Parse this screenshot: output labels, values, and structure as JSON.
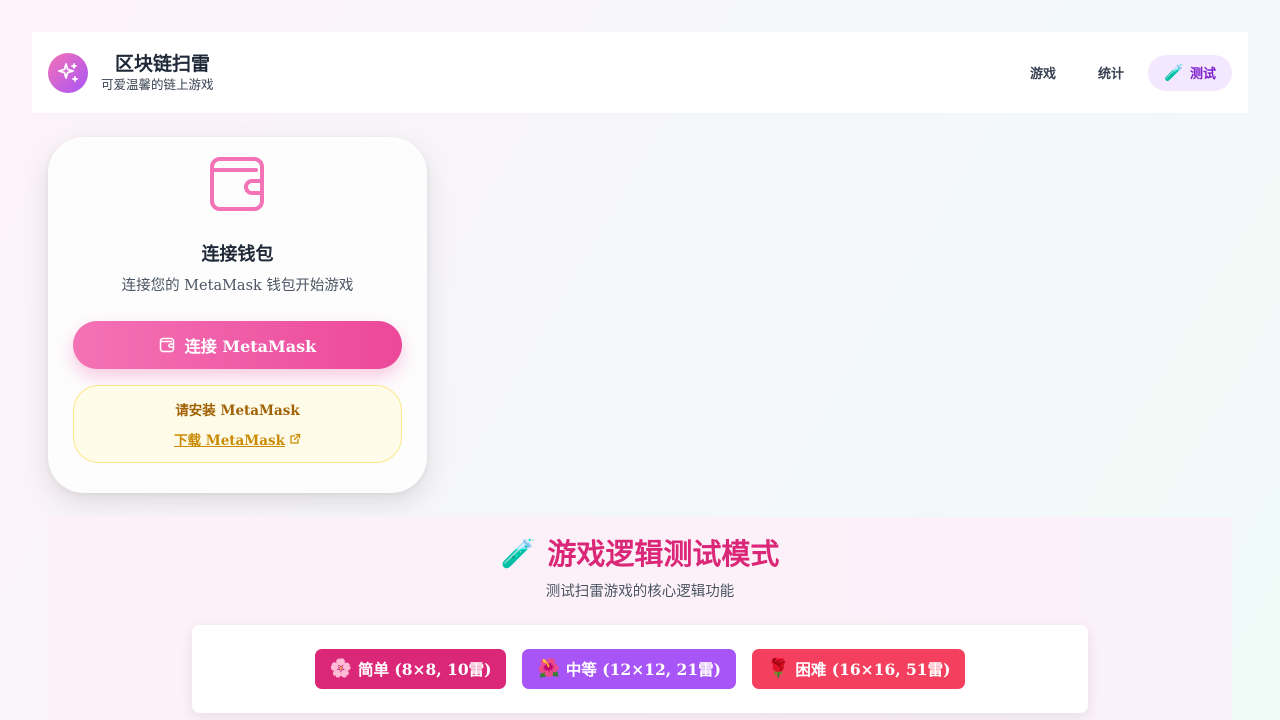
{
  "header": {
    "title": "区块链扫雷",
    "subtitle": "可爱温馨的链上游戏",
    "logo_icon": "sparkles-icon",
    "nav": [
      {
        "label": "游戏",
        "active": false
      },
      {
        "label": "统计",
        "active": false
      },
      {
        "label": "测试",
        "icon": "🧪",
        "active": true
      }
    ]
  },
  "wallet": {
    "icon": "wallet-icon",
    "title": "连接钱包",
    "description": "连接您的 MetaMask 钱包开始游戏",
    "connect_label": "连接 MetaMask",
    "install_title": "请安装 MetaMask",
    "download_label": "下载 MetaMask"
  },
  "test_mode": {
    "icon": "🧪",
    "title": "游戏逻辑测试模式",
    "subtitle": "测试扫雷游戏的核心逻辑功能",
    "difficulties": [
      {
        "icon": "🌸",
        "label": "简单 (8×8, 10雷)",
        "color": "#db2777"
      },
      {
        "icon": "🌺",
        "label": "中等 (12×12, 21雷)",
        "color": "#a855f7"
      },
      {
        "icon": "🌹",
        "label": "困难 (16×16, 51雷)",
        "color": "#f43f5e"
      }
    ]
  },
  "colors": {
    "accent_pink": "#ec4899",
    "accent_purple": "#a855f7",
    "warning_bg": "#fefce8"
  }
}
